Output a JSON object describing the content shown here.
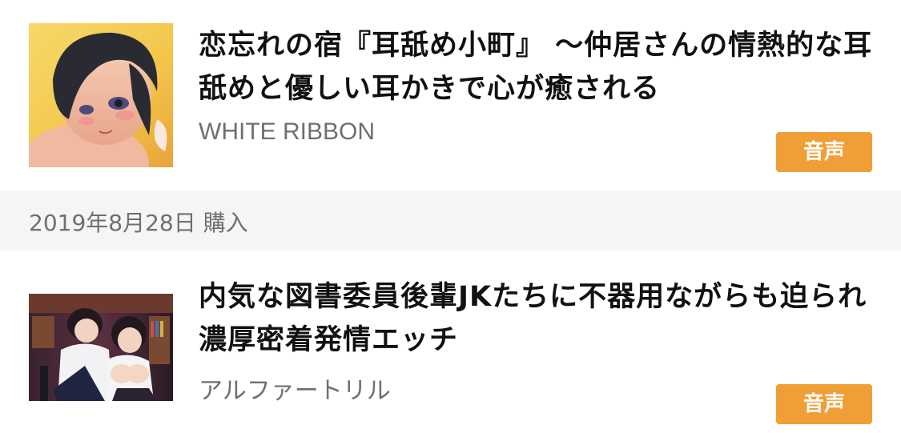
{
  "purchases": [
    {
      "title": "恋忘れの宿『耳舐め小町』 〜仲居さんの情熱的な耳舐めと優しい耳かきで心が癒される",
      "maker": "WHITE RIBBON",
      "category": "音声"
    },
    {
      "title": "内気な図書委員後輩JKたちに不器用ながらも迫られ濃厚密着発情エッチ",
      "maker": "アルファートリル",
      "category": "音声"
    }
  ],
  "date_header": "2019年8月28日 購入",
  "colors": {
    "badge": "#f09f36",
    "date_bar": "#f5f5f5",
    "maker_text": "#6f6f6f",
    "title_text": "#111111"
  }
}
